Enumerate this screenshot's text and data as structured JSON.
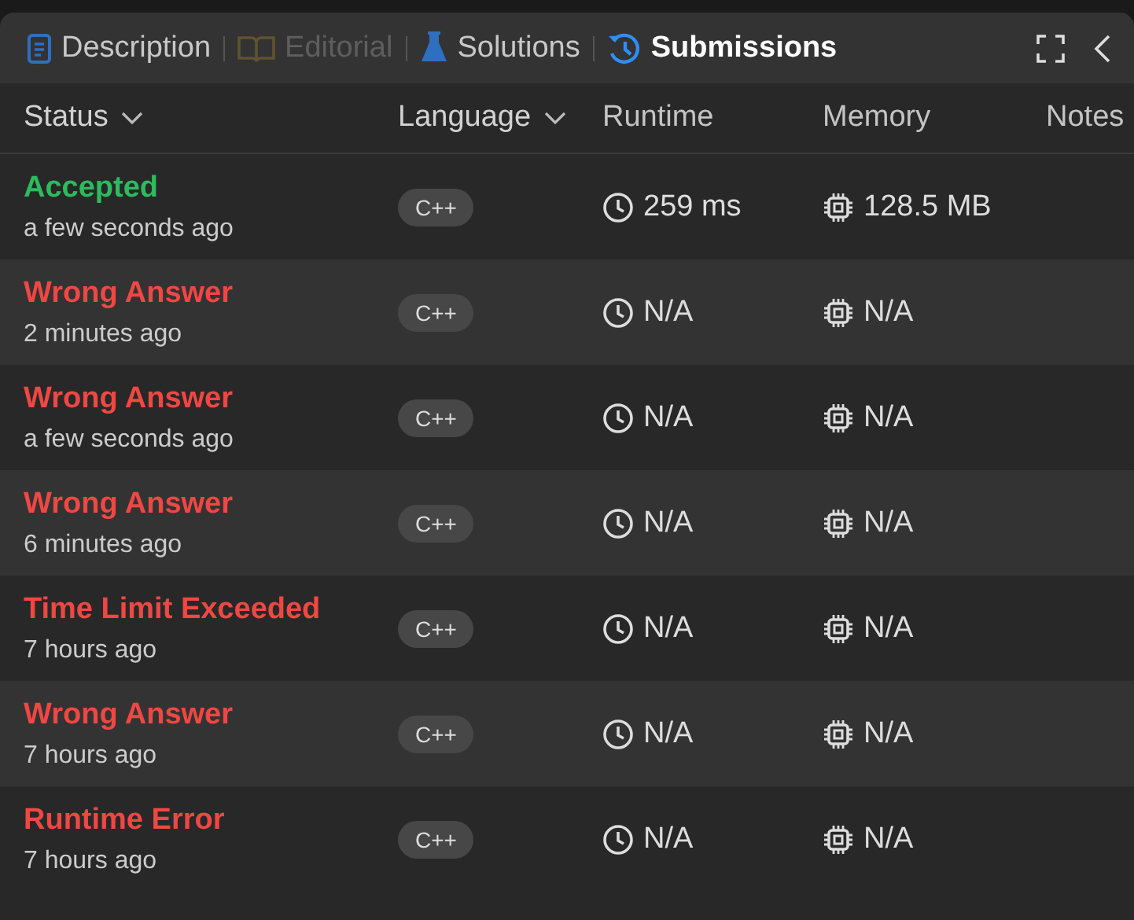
{
  "tabs": [
    {
      "label": "Description",
      "kind": "description",
      "selected": false,
      "disabled": false
    },
    {
      "label": "Editorial",
      "kind": "editorial",
      "selected": false,
      "disabled": true
    },
    {
      "label": "Solutions",
      "kind": "solutions",
      "selected": false,
      "disabled": false
    },
    {
      "label": "Submissions",
      "kind": "submissions",
      "selected": true,
      "disabled": false
    }
  ],
  "table": {
    "columns": [
      {
        "label": "Status",
        "sortable": true
      },
      {
        "label": "Language",
        "sortable": true
      },
      {
        "label": "Runtime",
        "sortable": false
      },
      {
        "label": "Memory",
        "sortable": false
      },
      {
        "label": "Notes",
        "sortable": false
      }
    ],
    "rows": [
      {
        "status": "Accepted",
        "accepted": true,
        "time": "a few seconds ago",
        "language": "C++",
        "runtime": "259 ms",
        "memory": "128.5 MB"
      },
      {
        "status": "Wrong Answer",
        "accepted": false,
        "time": "2 minutes ago",
        "language": "C++",
        "runtime": "N/A",
        "memory": "N/A"
      },
      {
        "status": "Wrong Answer",
        "accepted": false,
        "time": "a few seconds ago",
        "language": "C++",
        "runtime": "N/A",
        "memory": "N/A"
      },
      {
        "status": "Wrong Answer",
        "accepted": false,
        "time": "6 minutes ago",
        "language": "C++",
        "runtime": "N/A",
        "memory": "N/A"
      },
      {
        "status": "Time Limit Exceeded",
        "accepted": false,
        "time": "7 hours ago",
        "language": "C++",
        "runtime": "N/A",
        "memory": "N/A"
      },
      {
        "status": "Wrong Answer",
        "accepted": false,
        "time": "7 hours ago",
        "language": "C++",
        "runtime": "N/A",
        "memory": "N/A"
      },
      {
        "status": "Runtime Error",
        "accepted": false,
        "time": "7 hours ago",
        "language": "C++",
        "runtime": "N/A",
        "memory": "N/A"
      }
    ]
  }
}
